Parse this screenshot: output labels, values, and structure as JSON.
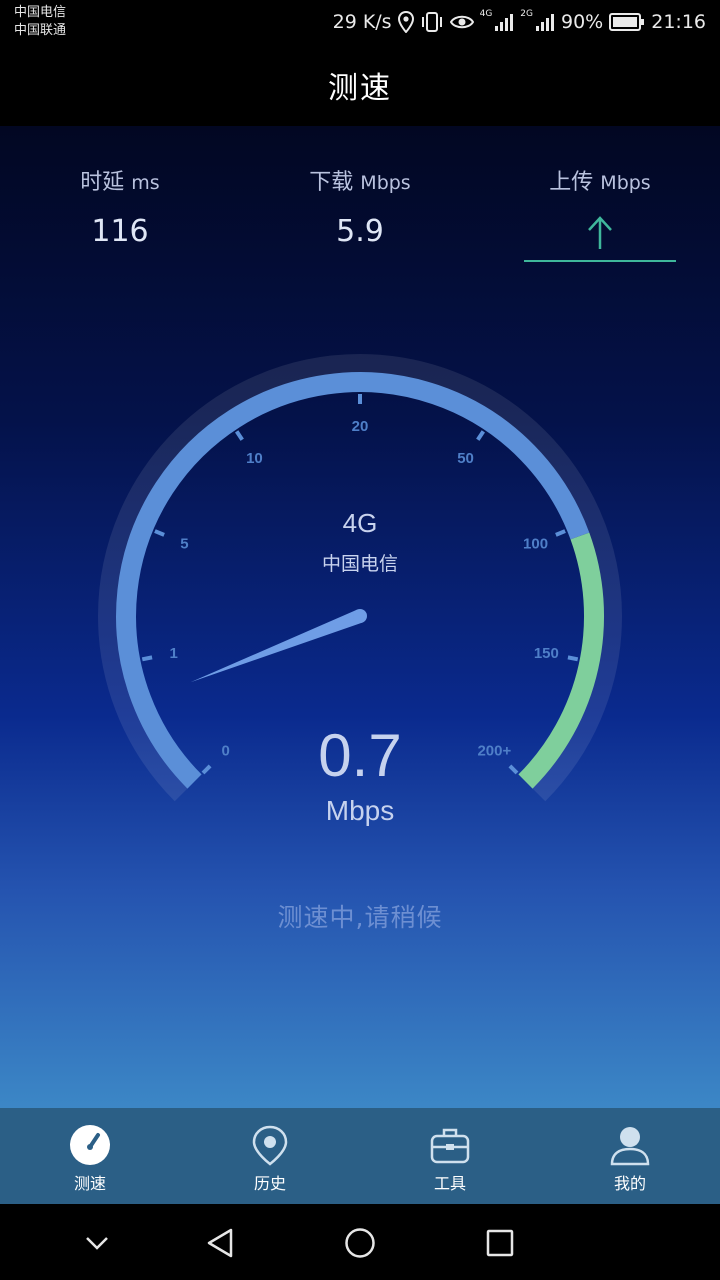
{
  "status_bar": {
    "carrier_1": "中国电信",
    "carrier_2": "中国联通",
    "net_speed": "29 K/s",
    "signal_1_tag": "4G",
    "signal_2_tag": "2G",
    "battery": "90%",
    "time": "21:16"
  },
  "header": {
    "title": "测速"
  },
  "metrics": {
    "latency": {
      "label": "时延",
      "unit": "ms",
      "value": "116"
    },
    "download": {
      "label": "下载",
      "unit": "Mbps",
      "value": "5.9"
    },
    "upload": {
      "label": "上传",
      "unit": "Mbps"
    }
  },
  "gauge": {
    "network": "4G",
    "carrier": "中国电信",
    "speed": "0.7",
    "unit": "Mbps",
    "scale_labels": [
      "0",
      "1",
      "5",
      "10",
      "20",
      "50",
      "100",
      "150",
      "200+"
    ]
  },
  "status_text": "测速中,请稍候",
  "bottom_nav": [
    {
      "label": "测速",
      "icon": "speedometer-icon"
    },
    {
      "label": "历史",
      "icon": "location-pin-icon"
    },
    {
      "label": "工具",
      "icon": "toolbox-icon"
    },
    {
      "label": "我的",
      "icon": "person-icon"
    }
  ],
  "colors": {
    "arc_blue": "#5b8fd8",
    "arc_green": "#7fcf9c",
    "nav_bg": "#2b5f86",
    "upload_line": "#3fb79b"
  }
}
